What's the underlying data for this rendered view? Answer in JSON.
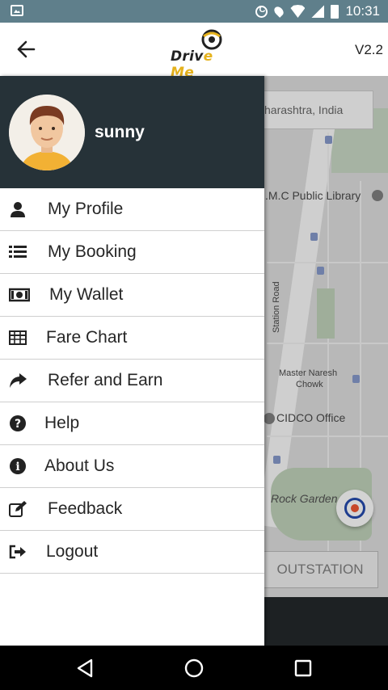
{
  "status_bar": {
    "time": "10:31"
  },
  "app_bar": {
    "logo": {
      "text_a": "Driv",
      "text_b": "e Me"
    },
    "version": "V2.2"
  },
  "map": {
    "location_text": "harashtra, India",
    "labels": {
      "library": ".M.C Public Library",
      "station_road": "Station Road",
      "master_naresh": "Master Naresh",
      "chowk": "Chowk",
      "cidco": "CIDCO Office",
      "rock_garden": "Rock Garden"
    },
    "outstation_label": "OUTSTATION"
  },
  "drawer": {
    "user_name": "sunny",
    "menu": [
      {
        "label": "My Profile",
        "icon": "user-icon"
      },
      {
        "label": "My Booking",
        "icon": "list-icon"
      },
      {
        "label": "My Wallet",
        "icon": "money-icon"
      },
      {
        "label": "Fare Chart",
        "icon": "table-icon"
      },
      {
        "label": "Refer and Earn",
        "icon": "share-icon"
      },
      {
        "label": "Help",
        "icon": "question-icon"
      },
      {
        "label": "About Us",
        "icon": "info-icon"
      },
      {
        "label": "Feedback",
        "icon": "edit-icon"
      },
      {
        "label": "Logout",
        "icon": "sign-out-icon"
      }
    ]
  },
  "colors": {
    "status_bar": "#5f7f8b",
    "drawer_header": "#263238",
    "logo_accent": "#e5b21c"
  }
}
